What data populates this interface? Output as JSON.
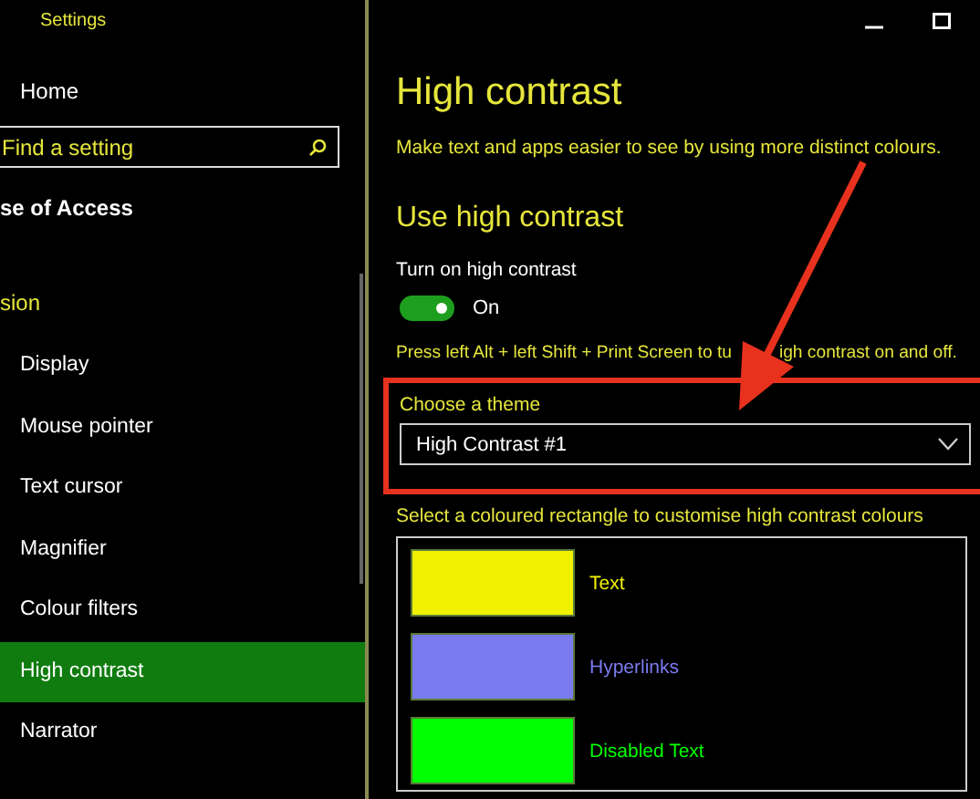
{
  "window": {
    "title": "Settings"
  },
  "sidebar": {
    "home": "Home",
    "search": {
      "placeholder": "Find a setting"
    },
    "category": "se of Access",
    "section": "sion",
    "items": [
      {
        "label": "Display",
        "selected": false
      },
      {
        "label": "Mouse pointer",
        "selected": false
      },
      {
        "label": "Text cursor",
        "selected": false
      },
      {
        "label": "Magnifier",
        "selected": false
      },
      {
        "label": "Colour filters",
        "selected": false
      },
      {
        "label": "High contrast",
        "selected": true
      },
      {
        "label": "Narrator",
        "selected": false
      }
    ]
  },
  "page": {
    "title": "High contrast",
    "description": "Make text and apps easier to see by using more distinct colours.",
    "section": "Use high contrast",
    "toggle": {
      "label": "Turn on high contrast",
      "on": true,
      "state_text": "On"
    },
    "hint_before": "Press left Alt + left Shift + Print Screen to tu",
    "hint_after": "igh contrast on and off.",
    "theme": {
      "label": "Choose a theme",
      "value": "High Contrast #1"
    },
    "colours_label": "Select a coloured rectangle to customise high contrast colours",
    "colours": [
      {
        "label": "Text",
        "color": "#f0f000"
      },
      {
        "label": "Hyperlinks",
        "color": "#7b7bf0"
      },
      {
        "label": "Disabled Text",
        "color": "#00ff00"
      }
    ]
  }
}
